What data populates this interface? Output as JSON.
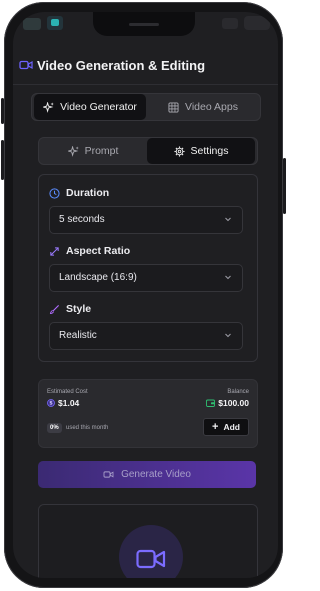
{
  "header": {
    "title": "Video Generation & Editing"
  },
  "top_tabs": [
    {
      "label": "Video Generator",
      "icon": "sparkles-icon",
      "active": true
    },
    {
      "label": "Video Apps",
      "icon": "grid-icon",
      "active": false
    }
  ],
  "sub_tabs": [
    {
      "label": "Prompt",
      "icon": "sparkles-icon",
      "active": false
    },
    {
      "label": "Settings",
      "icon": "gear-icon",
      "active": true
    }
  ],
  "settings": {
    "duration": {
      "label": "Duration",
      "value": "5 seconds",
      "icon": "clock-icon"
    },
    "aspect_ratio": {
      "label": "Aspect Ratio",
      "value": "Landscape (16:9)",
      "icon": "expand-icon"
    },
    "style": {
      "label": "Style",
      "value": "Realistic",
      "icon": "brush-icon"
    }
  },
  "cost": {
    "estimated_label": "Estimated Cost",
    "estimated_value": "$1.04",
    "balance_label": "Balance",
    "balance_value": "$100.00",
    "usage_percent": "0%",
    "usage_text": "used this month",
    "add_label": "Add"
  },
  "generate_label": "Generate Video",
  "colors": {
    "accent": "#5a35a8",
    "icon_blue": "#5b8cff",
    "balance_green": "#2fbf71",
    "cost_purple": "#7b6cff"
  }
}
